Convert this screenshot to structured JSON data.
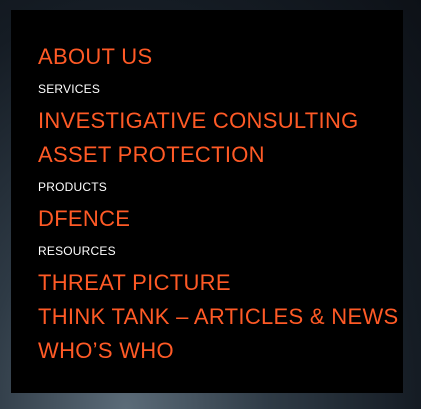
{
  "colors": {
    "link": "#ff5a26",
    "heading": "#ffffff",
    "panel": "#000000"
  },
  "menu": {
    "about_us": "ABOUT US",
    "services_heading": "SERVICES",
    "investigative_consulting": "INVESTIGATIVE CONSULTING",
    "asset_protection": "ASSET PROTECTION",
    "products_heading": "PRODUCTS",
    "dfence": "DFENCE",
    "resources_heading": "RESOURCES",
    "threat_picture": "THREAT PICTURE",
    "think_tank": "THINK TANK – ARTICLES & NEWS",
    "whos_who": "WHO’S WHO"
  }
}
